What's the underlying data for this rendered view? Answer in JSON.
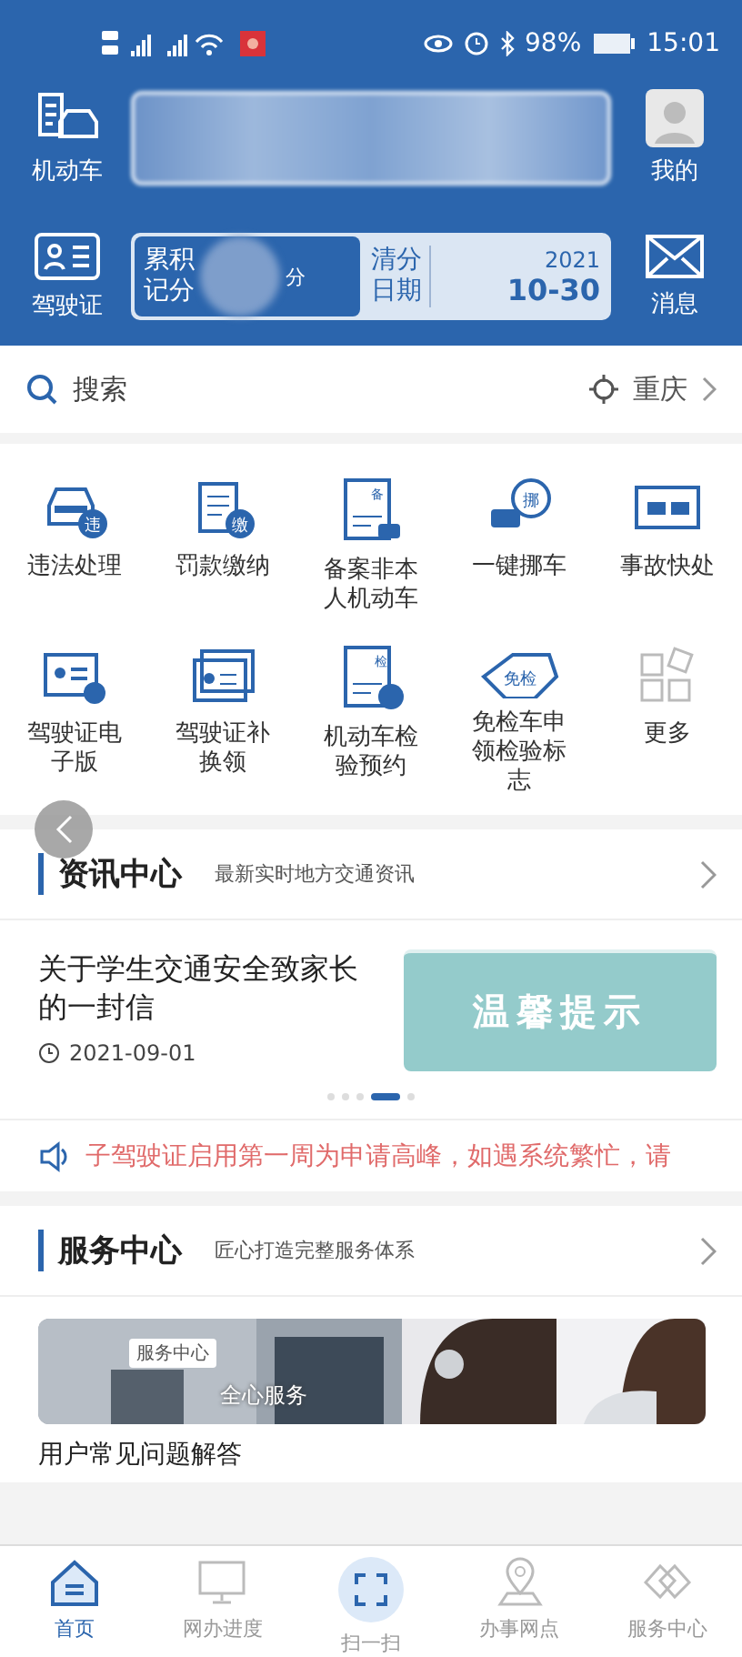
{
  "status_bar": {
    "battery": "98%",
    "time": "15:01"
  },
  "header": {
    "left_items": [
      {
        "label": "机动车"
      },
      {
        "label": "驾驶证"
      }
    ],
    "right_items": [
      {
        "label": "我的"
      },
      {
        "label": "消息"
      }
    ],
    "points_card": {
      "label_1": "累积",
      "label_2": "记分",
      "unit": "分",
      "clear_label_1": "清分",
      "clear_label_2": "日期",
      "year": "2021",
      "date": "10-30"
    }
  },
  "search": {
    "placeholder": "搜索",
    "city": "重庆"
  },
  "services": [
    {
      "label": "违法处理",
      "badge": "违"
    },
    {
      "label": "罚款缴纳",
      "badge": "缴"
    },
    {
      "label": "备案非本人机动车",
      "badge": "备"
    },
    {
      "label": "一键挪车",
      "badge": "挪"
    },
    {
      "label": "事故快处"
    },
    {
      "label": "驾驶证电子版"
    },
    {
      "label": "驾驶证补换领"
    },
    {
      "label": "机动车检验预约",
      "badge": "检"
    },
    {
      "label": "免检车申领检验标志",
      "badge": "免检"
    },
    {
      "label": "更多"
    }
  ],
  "news": {
    "title": "资讯中心",
    "subtitle": "最新实时地方交通资讯",
    "article": {
      "title": "关于学生交通安全致家长的一封信",
      "date": "2021-09-01",
      "thumb_text": "温馨提示"
    },
    "dots": [
      {
        "selected": false
      },
      {
        "selected": false
      },
      {
        "selected": false
      },
      {
        "selected": true
      },
      {
        "selected": false
      }
    ]
  },
  "notice": "子驾驶证启用第一周为申请高峰，如遇系统繁忙，请",
  "service_center": {
    "title": "服务中心",
    "subtitle": "匠心打造完整服务体系",
    "banner_tag": "服务中心",
    "banner_caption": "全心服务",
    "faq": "用户常见问题解答"
  },
  "tabs": [
    {
      "label": "首页",
      "selected": true
    },
    {
      "label": "网办进度",
      "selected": false
    },
    {
      "label": "扫一扫",
      "selected": false
    },
    {
      "label": "办事网点",
      "selected": false
    },
    {
      "label": "服务中心",
      "selected": false
    }
  ]
}
